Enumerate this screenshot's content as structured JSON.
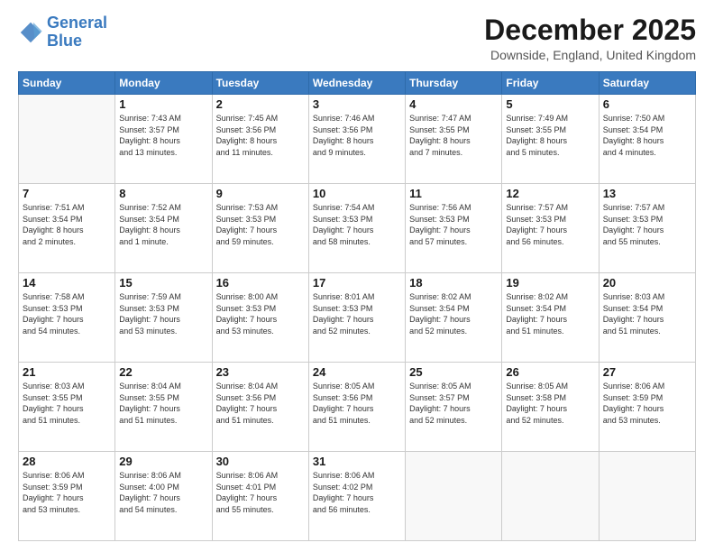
{
  "logo": {
    "line1": "General",
    "line2": "Blue"
  },
  "header": {
    "title": "December 2025",
    "location": "Downside, England, United Kingdom"
  },
  "days_of_week": [
    "Sunday",
    "Monday",
    "Tuesday",
    "Wednesday",
    "Thursday",
    "Friday",
    "Saturday"
  ],
  "weeks": [
    [
      {
        "day": "",
        "info": ""
      },
      {
        "day": "1",
        "info": "Sunrise: 7:43 AM\nSunset: 3:57 PM\nDaylight: 8 hours\nand 13 minutes."
      },
      {
        "day": "2",
        "info": "Sunrise: 7:45 AM\nSunset: 3:56 PM\nDaylight: 8 hours\nand 11 minutes."
      },
      {
        "day": "3",
        "info": "Sunrise: 7:46 AM\nSunset: 3:56 PM\nDaylight: 8 hours\nand 9 minutes."
      },
      {
        "day": "4",
        "info": "Sunrise: 7:47 AM\nSunset: 3:55 PM\nDaylight: 8 hours\nand 7 minutes."
      },
      {
        "day": "5",
        "info": "Sunrise: 7:49 AM\nSunset: 3:55 PM\nDaylight: 8 hours\nand 5 minutes."
      },
      {
        "day": "6",
        "info": "Sunrise: 7:50 AM\nSunset: 3:54 PM\nDaylight: 8 hours\nand 4 minutes."
      }
    ],
    [
      {
        "day": "7",
        "info": "Sunrise: 7:51 AM\nSunset: 3:54 PM\nDaylight: 8 hours\nand 2 minutes."
      },
      {
        "day": "8",
        "info": "Sunrise: 7:52 AM\nSunset: 3:54 PM\nDaylight: 8 hours\nand 1 minute."
      },
      {
        "day": "9",
        "info": "Sunrise: 7:53 AM\nSunset: 3:53 PM\nDaylight: 7 hours\nand 59 minutes."
      },
      {
        "day": "10",
        "info": "Sunrise: 7:54 AM\nSunset: 3:53 PM\nDaylight: 7 hours\nand 58 minutes."
      },
      {
        "day": "11",
        "info": "Sunrise: 7:56 AM\nSunset: 3:53 PM\nDaylight: 7 hours\nand 57 minutes."
      },
      {
        "day": "12",
        "info": "Sunrise: 7:57 AM\nSunset: 3:53 PM\nDaylight: 7 hours\nand 56 minutes."
      },
      {
        "day": "13",
        "info": "Sunrise: 7:57 AM\nSunset: 3:53 PM\nDaylight: 7 hours\nand 55 minutes."
      }
    ],
    [
      {
        "day": "14",
        "info": "Sunrise: 7:58 AM\nSunset: 3:53 PM\nDaylight: 7 hours\nand 54 minutes."
      },
      {
        "day": "15",
        "info": "Sunrise: 7:59 AM\nSunset: 3:53 PM\nDaylight: 7 hours\nand 53 minutes."
      },
      {
        "day": "16",
        "info": "Sunrise: 8:00 AM\nSunset: 3:53 PM\nDaylight: 7 hours\nand 53 minutes."
      },
      {
        "day": "17",
        "info": "Sunrise: 8:01 AM\nSunset: 3:53 PM\nDaylight: 7 hours\nand 52 minutes."
      },
      {
        "day": "18",
        "info": "Sunrise: 8:02 AM\nSunset: 3:54 PM\nDaylight: 7 hours\nand 52 minutes."
      },
      {
        "day": "19",
        "info": "Sunrise: 8:02 AM\nSunset: 3:54 PM\nDaylight: 7 hours\nand 51 minutes."
      },
      {
        "day": "20",
        "info": "Sunrise: 8:03 AM\nSunset: 3:54 PM\nDaylight: 7 hours\nand 51 minutes."
      }
    ],
    [
      {
        "day": "21",
        "info": "Sunrise: 8:03 AM\nSunset: 3:55 PM\nDaylight: 7 hours\nand 51 minutes."
      },
      {
        "day": "22",
        "info": "Sunrise: 8:04 AM\nSunset: 3:55 PM\nDaylight: 7 hours\nand 51 minutes."
      },
      {
        "day": "23",
        "info": "Sunrise: 8:04 AM\nSunset: 3:56 PM\nDaylight: 7 hours\nand 51 minutes."
      },
      {
        "day": "24",
        "info": "Sunrise: 8:05 AM\nSunset: 3:56 PM\nDaylight: 7 hours\nand 51 minutes."
      },
      {
        "day": "25",
        "info": "Sunrise: 8:05 AM\nSunset: 3:57 PM\nDaylight: 7 hours\nand 52 minutes."
      },
      {
        "day": "26",
        "info": "Sunrise: 8:05 AM\nSunset: 3:58 PM\nDaylight: 7 hours\nand 52 minutes."
      },
      {
        "day": "27",
        "info": "Sunrise: 8:06 AM\nSunset: 3:59 PM\nDaylight: 7 hours\nand 53 minutes."
      }
    ],
    [
      {
        "day": "28",
        "info": "Sunrise: 8:06 AM\nSunset: 3:59 PM\nDaylight: 7 hours\nand 53 minutes."
      },
      {
        "day": "29",
        "info": "Sunrise: 8:06 AM\nSunset: 4:00 PM\nDaylight: 7 hours\nand 54 minutes."
      },
      {
        "day": "30",
        "info": "Sunrise: 8:06 AM\nSunset: 4:01 PM\nDaylight: 7 hours\nand 55 minutes."
      },
      {
        "day": "31",
        "info": "Sunrise: 8:06 AM\nSunset: 4:02 PM\nDaylight: 7 hours\nand 56 minutes."
      },
      {
        "day": "",
        "info": ""
      },
      {
        "day": "",
        "info": ""
      },
      {
        "day": "",
        "info": ""
      }
    ]
  ]
}
